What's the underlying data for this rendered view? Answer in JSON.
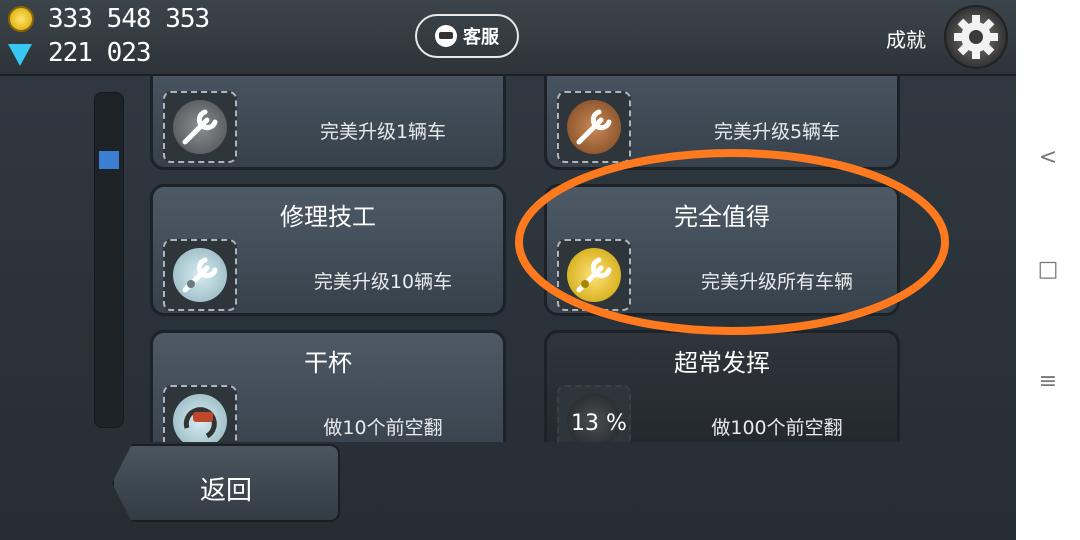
{
  "header": {
    "coins": "333 548 353",
    "gems": "221 023",
    "support_label": "客服",
    "achievements_label": "成就"
  },
  "cards": [
    {
      "id": "top-left",
      "title": "",
      "desc": "完美升级1辆车",
      "medal": "grey-wrench-medal"
    },
    {
      "id": "top-right",
      "title": "",
      "desc": "完美升级5辆车",
      "medal": "bronze-wrench-medal"
    },
    {
      "id": "mechanic",
      "title": "修理技工",
      "desc": "完美升级10辆车",
      "medal": "silver-wrench-medal"
    },
    {
      "id": "worth-it",
      "title": "完全值得",
      "desc": "完美升级所有车辆",
      "medal": "gold-wrench-medal"
    },
    {
      "id": "cheers",
      "title": "干杯",
      "desc": "做10个前空翻",
      "medal": "flip-medal"
    },
    {
      "id": "outstanding",
      "title": "超常发挥",
      "desc": "做100个前空翻",
      "medal": "locked-medal",
      "progress": "13 %"
    }
  ],
  "footer": {
    "back_label": "返回"
  },
  "navbar": {
    "back_symbol": "<",
    "home_symbol": "□",
    "menu_symbol": "≡"
  },
  "colors": {
    "highlight": "#ff7a1f",
    "scroll_thumb": "#3a7fd2",
    "coin": "#f2c21a",
    "gem": "#38c6f2"
  }
}
